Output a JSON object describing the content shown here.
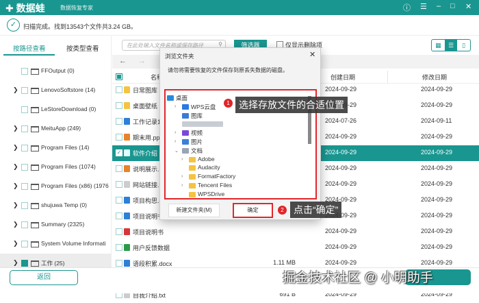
{
  "app": {
    "logo": "数据蛙",
    "subtitle": "数据恢复专家",
    "help_icon": "help-circle-icon",
    "menu_icon": "hamburger-icon"
  },
  "colors": {
    "accent": "#1a9690",
    "annotation": "#e0262b"
  },
  "status": {
    "text": "扫描完成。找到13543个文件共3.24 GB。"
  },
  "sidebar": {
    "tabs": [
      "按路径查看",
      "按类型查看"
    ],
    "active_tab": 0,
    "items": [
      {
        "label": "FFOutput (0)",
        "expand": false
      },
      {
        "label": "LenovoSoftstore (14)",
        "expand": true
      },
      {
        "label": "LeStoreDownload (0)",
        "expand": false
      },
      {
        "label": "MeituApp (249)",
        "expand": true
      },
      {
        "label": "Program Files (14)",
        "expand": true
      },
      {
        "label": "Program Files (1074)",
        "expand": true
      },
      {
        "label": "Program Files (x86) (1976",
        "expand": true
      },
      {
        "label": "shujuwa Temp (0)",
        "expand": true
      },
      {
        "label": "Summary (2325)",
        "expand": true
      },
      {
        "label": "System Volume Informati",
        "expand": true
      },
      {
        "label": "工作 (25)",
        "expand": true,
        "checked": true
      }
    ]
  },
  "toolbar": {
    "search_placeholder": "在此处输入文件名称或保存路径",
    "filter": "筛选器",
    "deleted_only": "仅显示删除项"
  },
  "table": {
    "headers": {
      "name": "名称",
      "created": "创建日期",
      "modified": "修改日期"
    },
    "rows": [
      {
        "name": "日常图库",
        "size": "",
        "created": "2024-09-29",
        "modified": "2024-09-29",
        "type": "folder"
      },
      {
        "name": "桌面壁纸",
        "size": "",
        "created": "2024-09-29",
        "modified": "2024-09-29",
        "type": "folder"
      },
      {
        "name": "工作记录1.",
        "size": "",
        "created": "2024-07-26",
        "modified": "2024-09-11",
        "type": "doc"
      },
      {
        "name": "期末用.ppt",
        "size": "",
        "created": "2024-09-29",
        "modified": "2024-09-29",
        "type": "ppt"
      },
      {
        "name": "软件介绍 -",
        "size": "",
        "created": "2024-09-29",
        "modified": "2024-09-29",
        "type": "txt",
        "selected": true
      },
      {
        "name": "说明展示.p",
        "size": "",
        "created": "2024-09-29",
        "modified": "2024-09-29",
        "type": "ppt"
      },
      {
        "name": "网站链接.t",
        "size": "",
        "created": "2024-09-29",
        "modified": "2024-09-29",
        "type": "txt"
      },
      {
        "name": "项目构思.d",
        "size": "",
        "created": "2024-09-29",
        "modified": "2024-09-29",
        "type": "doc"
      },
      {
        "name": "项目说明书",
        "size": "",
        "created": "2024-09-29",
        "modified": "2024-09-29",
        "type": "doc"
      },
      {
        "name": "项目说明书",
        "size": "",
        "created": "2024-09-29",
        "modified": "2024-09-29",
        "type": "pdf"
      },
      {
        "name": "用户反馈数据",
        "size": "",
        "created": "2024-09-29",
        "modified": "2024-09-29",
        "type": "xls"
      },
      {
        "name": "语段积累.docx",
        "size": "1.11 MB",
        "created": "2024-09-29",
        "modified": "2024-09-29",
        "type": "doc"
      },
      {
        "name": "自我介绍.pptx",
        "size": "449 KB",
        "created": "2024-09-29",
        "modified": "2024-09-29",
        "type": "ppt"
      },
      {
        "name": "自我介绍.txt",
        "size": "691 B",
        "created": "2024-09-29",
        "modified": "2024-09-29",
        "type": "txt"
      }
    ]
  },
  "dialog": {
    "title": "浏览文件夹",
    "message": "请勿将需要恢复的文件保存到原丢失数据的磁盘。",
    "tree": [
      {
        "label": "桌面",
        "level": 0,
        "arrow": false,
        "icon": "desktop"
      },
      {
        "label": "WPS云盘",
        "level": 1,
        "arrow": true,
        "icon": "cloud"
      },
      {
        "label": "图库",
        "level": 1,
        "arrow": false,
        "icon": "gallery"
      },
      {
        "label": "",
        "level": 1,
        "arrow": false,
        "icon": "blurred"
      },
      {
        "label": "视频",
        "level": 1,
        "arrow": true,
        "icon": "video"
      },
      {
        "label": "图片",
        "level": 1,
        "arrow": true,
        "icon": "picture"
      },
      {
        "label": "文档",
        "level": 1,
        "arrow": true,
        "open": true,
        "icon": "document"
      },
      {
        "label": "Adobe",
        "level": 2,
        "arrow": true,
        "icon": "folder"
      },
      {
        "label": "Audacity",
        "level": 2,
        "arrow": false,
        "icon": "folder"
      },
      {
        "label": "FormatFactory",
        "level": 2,
        "arrow": true,
        "icon": "folder"
      },
      {
        "label": "Tencent Files",
        "level": 2,
        "arrow": true,
        "icon": "folder"
      },
      {
        "label": "WPSDrive",
        "level": 2,
        "arrow": false,
        "icon": "folder"
      }
    ],
    "new_folder": "新建文件夹(M)",
    "ok": "确定"
  },
  "annotations": [
    {
      "num": "1",
      "text": "选择存放文件的合适位置"
    },
    {
      "num": "2",
      "text": "点击“确定”"
    }
  ],
  "footer": {
    "back": "返回"
  },
  "watermark": "掘金技术社区 @ 小明助手"
}
